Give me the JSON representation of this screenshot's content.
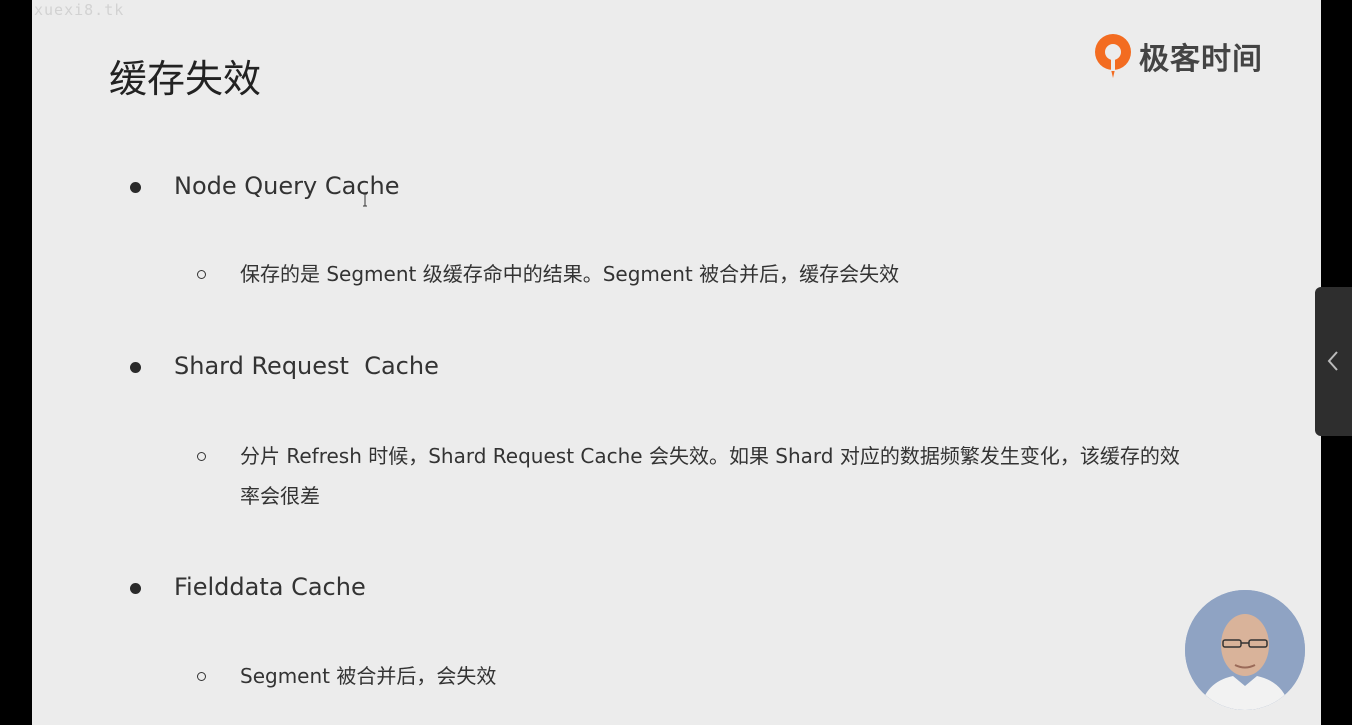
{
  "watermark": "xuexi8.tk",
  "slide": {
    "title": "缓存失效",
    "logo_text": "极客时间",
    "brand_color": "#f36c21",
    "items": [
      {
        "label": "Node Query Cache",
        "detail_lines": [
          "保存的是 Segment 级缓存命中的结果。Segment 被合并后，缓存会失效"
        ]
      },
      {
        "label": "Shard Request  Cache",
        "detail_lines": [
          "分片 Refresh 时候，Shard Request Cache 会失效。如果 Shard 对应的数据频繁发生变化，该缓存的效",
          "率会很差"
        ]
      },
      {
        "label": "Fielddata Cache",
        "detail_lines": [
          "Segment 被合并后，会失效"
        ]
      }
    ]
  },
  "icons": {
    "side_tab": "chevron-left-icon",
    "presenter": "presenter-video-avatar",
    "logo": "geektime-logo-icon",
    "cursor": "text-cursor-icon"
  }
}
